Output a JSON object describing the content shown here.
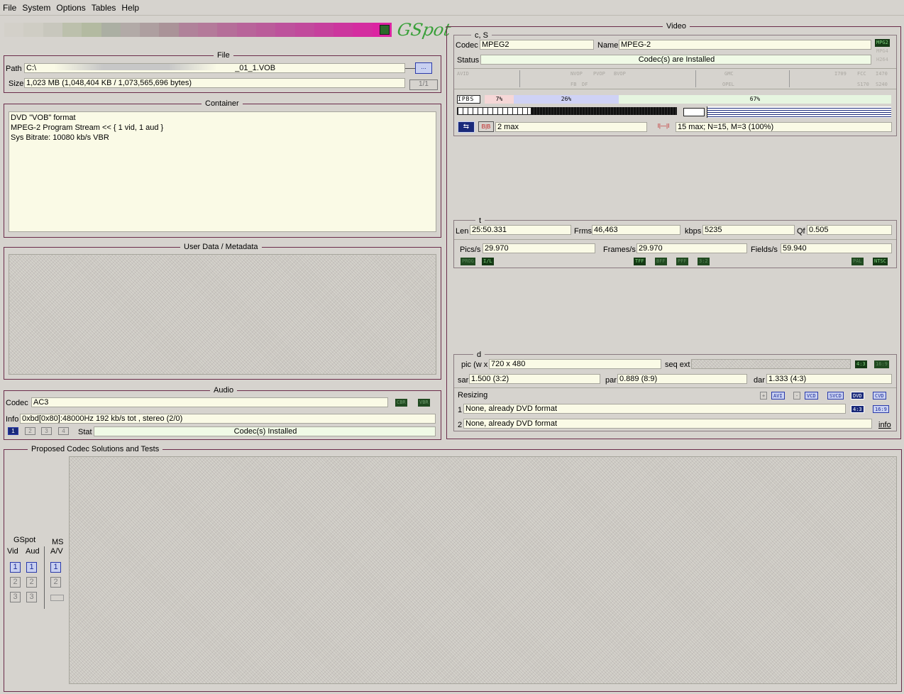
{
  "menu": [
    "File",
    "System",
    "Options",
    "Tables",
    "Help"
  ],
  "swatches": [
    "#d3d0c9",
    "#cfcdc4",
    "#c8c7bd",
    "#bcc0ac",
    "#b3baa1",
    "#abafa3",
    "#b2aaa7",
    "#ae9fa0",
    "#aa9398",
    "#b0829a",
    "#b47a9a",
    "#b56e99",
    "#b8649a",
    "#ba5c9a",
    "#bd529c",
    "#c14a9c",
    "#c6409d",
    "#cc369e",
    "#d42da0",
    "#dc24a2"
  ],
  "logo": "GSpot",
  "file": {
    "title": "File",
    "path_label": "Path",
    "path_prefix": "C:\\",
    "path_suffix": "_01_1.VOB",
    "browse": "...",
    "size_label": "Size",
    "size": "1,023 MB (1,048,404 KB / 1,073,565,696 bytes)",
    "page": "1/1"
  },
  "container": {
    "title": "Container",
    "lines": [
      "DVD \"VOB\" format",
      "MPEG-2 Program Stream << { 1 vid, 1 aud }",
      "Sys Bitrate: 10080 kb/s VBR"
    ]
  },
  "userdata": {
    "title": "User Data / Metadata"
  },
  "audio": {
    "title": "Audio",
    "codec_label": "Codec",
    "codec": "AC3",
    "cbr": "CBR",
    "vbr": "VBR",
    "info_label": "Info",
    "info": "0xbd[0x80]:48000Hz  192 kb/s tot , stereo (2/0)",
    "streams": [
      "1",
      "2",
      "3",
      "4"
    ],
    "stat_label": "Stat",
    "stat": "Codec(s) Installed"
  },
  "video": {
    "title": "Video",
    "cs_title": "c, S",
    "codec_label": "Codec",
    "codec": "MPEG2",
    "name_label": "Name",
    "name": "MPEG-2",
    "status_label": "Status",
    "status": "Codec(s) are Installed",
    "codec_tags": [
      "MPG2",
      "MPG4",
      "H264"
    ],
    "flags_row1": [
      "AVID",
      "NVOP",
      "PVOP",
      "BVOP",
      "GMC",
      "I709",
      "FCC",
      "I470"
    ],
    "flags_row2": [
      "FB",
      "DF",
      "OPEL",
      "S170",
      "S240"
    ],
    "ipbs": "IPBS",
    "pct_i": "7%",
    "pct_p": "26%",
    "pct_b": "67%",
    "bb": "2 max",
    "gop": "15 max; N=15, M=3 (100%)",
    "t_title": "t",
    "len_label": "Len",
    "len": "25:50.331",
    "frms_label": "Frms",
    "frms": "46,463",
    "kbps_label": "kbps",
    "kbps": "5235",
    "qf_label": "Qf",
    "qf": "0.505",
    "pics_label": "Pics/s",
    "pics": "29.970",
    "frames_label": "Frames/s",
    "frames": "29.970",
    "fields_label": "Fields/s",
    "fields": "59.940",
    "scan_tags": [
      "PROG",
      "I/L",
      "TFF",
      "BFF",
      "PFF",
      "3:2",
      "PAL",
      "NTSC"
    ],
    "d_title": "d",
    "pic_label": "pic (w x",
    "pic": "720 x 480",
    "seqext_label": "seq ext",
    "ar_tags": [
      "4:3",
      "16:9"
    ],
    "sar_label": "sar",
    "sar": "1.500 (3:2)",
    "par_label": "par",
    "par": "0.889 (8:9)",
    "dar_label": "dar",
    "dar": "1.333 (4:3)",
    "resizing_label": "Resizing",
    "resize_btns": [
      "+",
      "AVI",
      "-",
      "VCD",
      "SVCD",
      "DVD",
      "CVD"
    ],
    "r1": "None, already DVD format",
    "r2": "None, already DVD format",
    "r1n": "1",
    "r2n": "2",
    "info_link": "info"
  },
  "proposed": {
    "title": "Proposed Codec Solutions and Tests",
    "gspot": "GSpot",
    "vid": "Vid",
    "aud": "Aud",
    "ms": "MS",
    "av": "A/V",
    "nums": [
      "1",
      "2",
      "3"
    ]
  }
}
